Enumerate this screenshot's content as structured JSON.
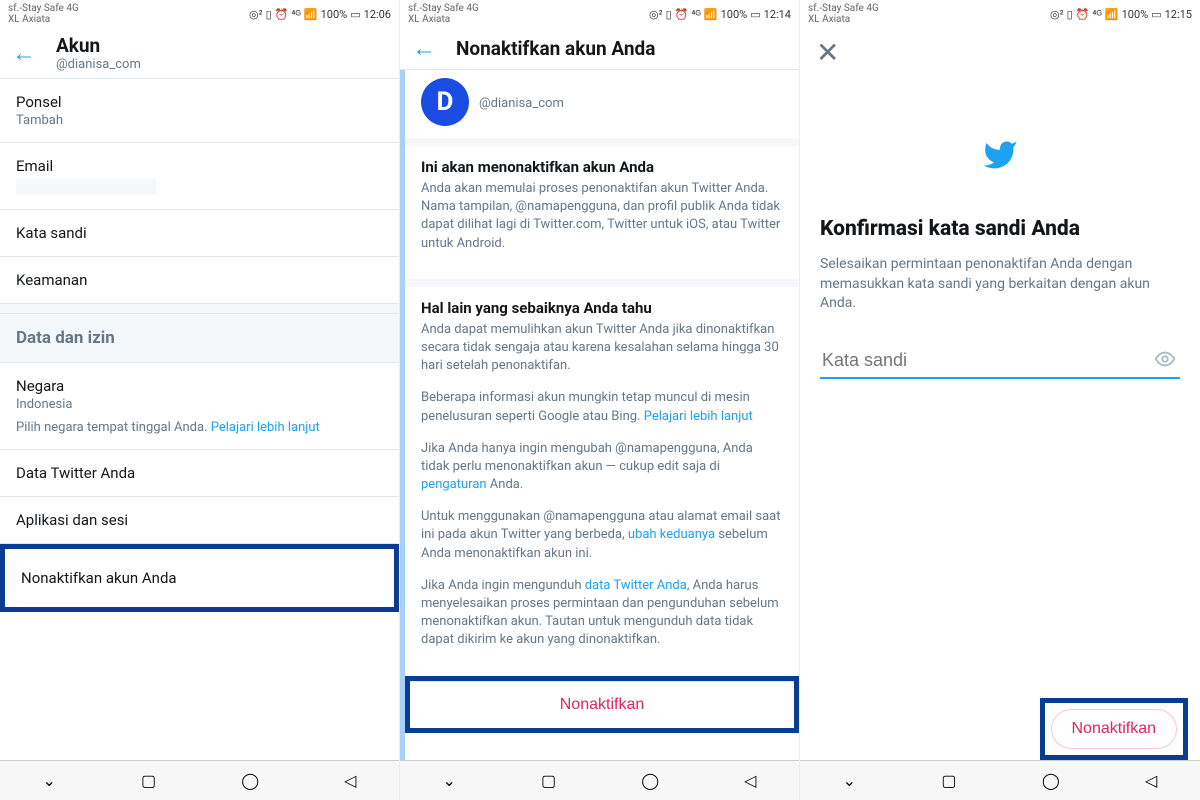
{
  "status": {
    "carrier_line1": "sf.-Stay Safe 4G",
    "carrier_line2": "XL Axiata",
    "signal_text": "100%",
    "times": [
      "12:06",
      "12:14",
      "12:15"
    ]
  },
  "phone1": {
    "header_title": "Akun",
    "header_handle": "@dianisa_com",
    "rows": {
      "phone_label": "Ponsel",
      "phone_sub": "Tambah",
      "email_label": "Email",
      "password_label": "Kata sandi",
      "security_label": "Keamanan",
      "section_data": "Data dan izin",
      "country_label": "Negara",
      "country_value": "Indonesia",
      "country_desc": "Pilih negara tempat tinggal Anda. ",
      "learn_more": "Pelajari lebih lanjut",
      "twitter_data": "Data Twitter Anda",
      "apps_sessions": "Aplikasi dan sesi",
      "deactivate": "Nonaktifkan akun Anda"
    }
  },
  "phone2": {
    "header_title": "Nonaktifkan akun Anda",
    "handle": "@dianisa_com",
    "h1": "Ini akan menonaktifkan akun Anda",
    "t1": "Anda akan memulai proses penonaktifan akun Twitter Anda. Nama tampilan, @namapengguna, dan profil publik Anda tidak dapat dilihat lagi di Twitter.com, Twitter untuk iOS, atau Twitter untuk Android.",
    "h2": "Hal lain yang sebaiknya Anda tahu",
    "t2": "Anda dapat memulihkan akun Twitter Anda jika dinonaktifkan secara tidak sengaja atau karena kesalahan selama hingga 30 hari setelah penonaktifan.",
    "t3a": "Beberapa informasi akun mungkin tetap muncul di mesin penelusuran seperti Google atau Bing. ",
    "t3link": "Pelajari lebih lanjut",
    "t4a": "Jika Anda hanya ingin mengubah @namapengguna, Anda tidak perlu menonaktifkan akun — cukup edit saja di ",
    "t4link": "pengaturan",
    "t4b": " Anda.",
    "t5a": "Untuk menggunakan @namapengguna atau alamat email saat ini pada akun Twitter yang berbeda, ",
    "t5link": "ubah keduanya",
    "t5b": " sebelum Anda menonaktifkan akun ini.",
    "t6a": "Jika Anda ingin mengunduh ",
    "t6link": "data Twitter Anda",
    "t6b": ", Anda harus menyelesaikan proses permintaan dan pengunduhan sebelum menonaktifkan akun. Tautan untuk mengunduh data tidak dapat dikirim ke akun yang dinonaktifkan.",
    "button": "Nonaktifkan"
  },
  "phone3": {
    "title": "Konfirmasi kata sandi Anda",
    "desc": "Selesaikan permintaan penonaktifan Anda dengan memasukkan kata sandi yang berkaitan dengan akun Anda.",
    "placeholder": "Kata sandi",
    "button": "Nonaktifkan"
  }
}
